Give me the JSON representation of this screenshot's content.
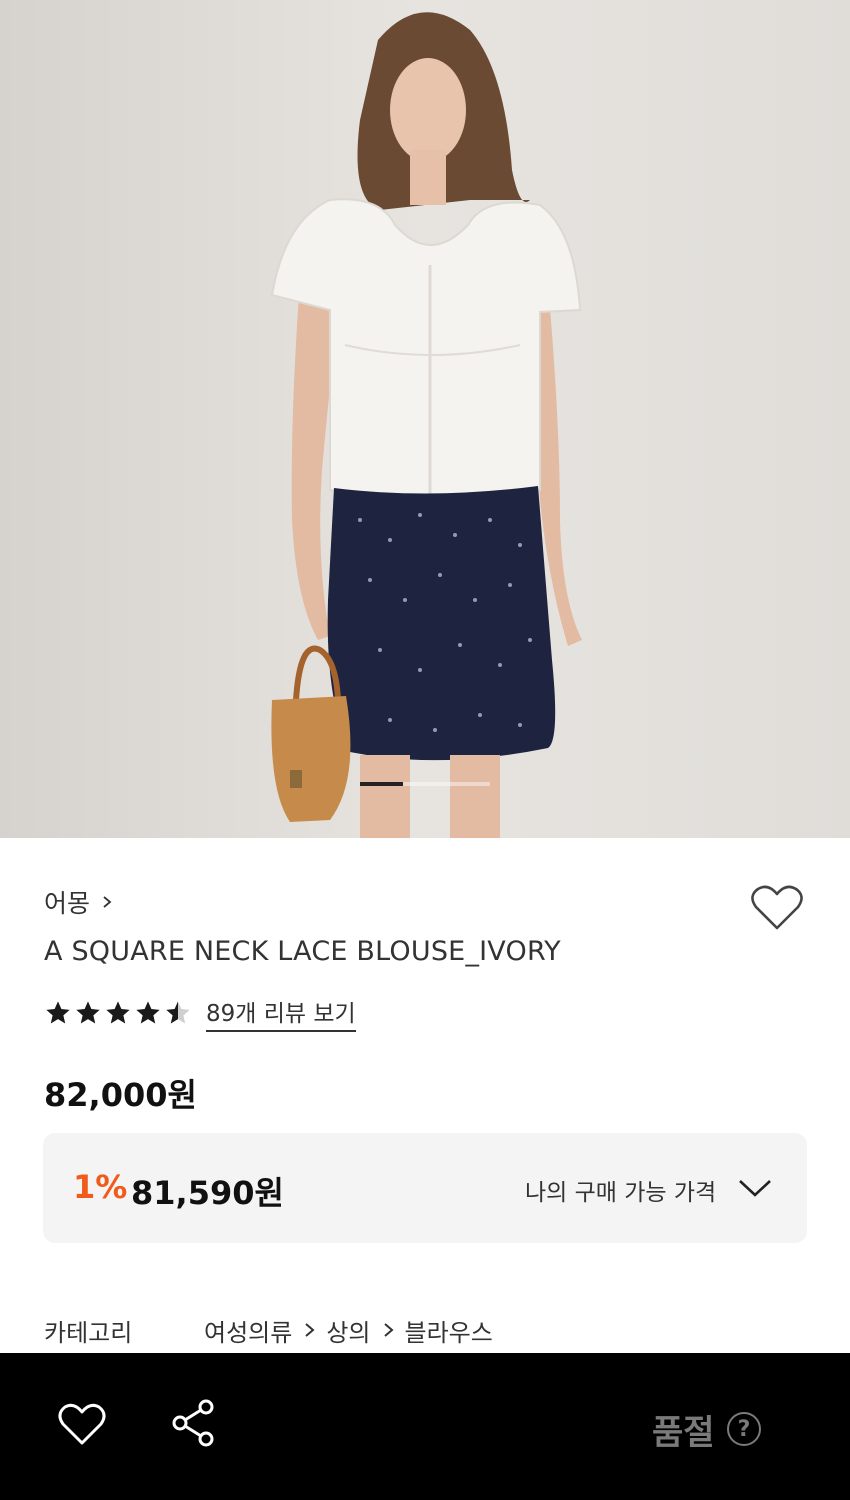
{
  "hero": {
    "image_alt": "model wearing white square neck lace blouse and navy dotted skirt",
    "slide_index": 1,
    "slide_count": 3
  },
  "product": {
    "brand": "어몽",
    "title": "A SQUARE NECK LACE BLOUSE_IVORY",
    "rating": 4.5,
    "review_link": "89개 리뷰 보기",
    "price": "82,000원",
    "deal": {
      "discount": "1%",
      "price": "81,590원",
      "label": "나의 구매 가능 가격"
    },
    "category": {
      "label": "카테고리",
      "path": [
        "여성의류",
        "상의",
        "블라우스"
      ]
    }
  },
  "bottom_bar": {
    "status": "품절",
    "help_glyph": "?"
  },
  "colors": {
    "accent": "#f05a1a",
    "bar_bg": "#000000",
    "box_bg": "#f4f4f4"
  }
}
